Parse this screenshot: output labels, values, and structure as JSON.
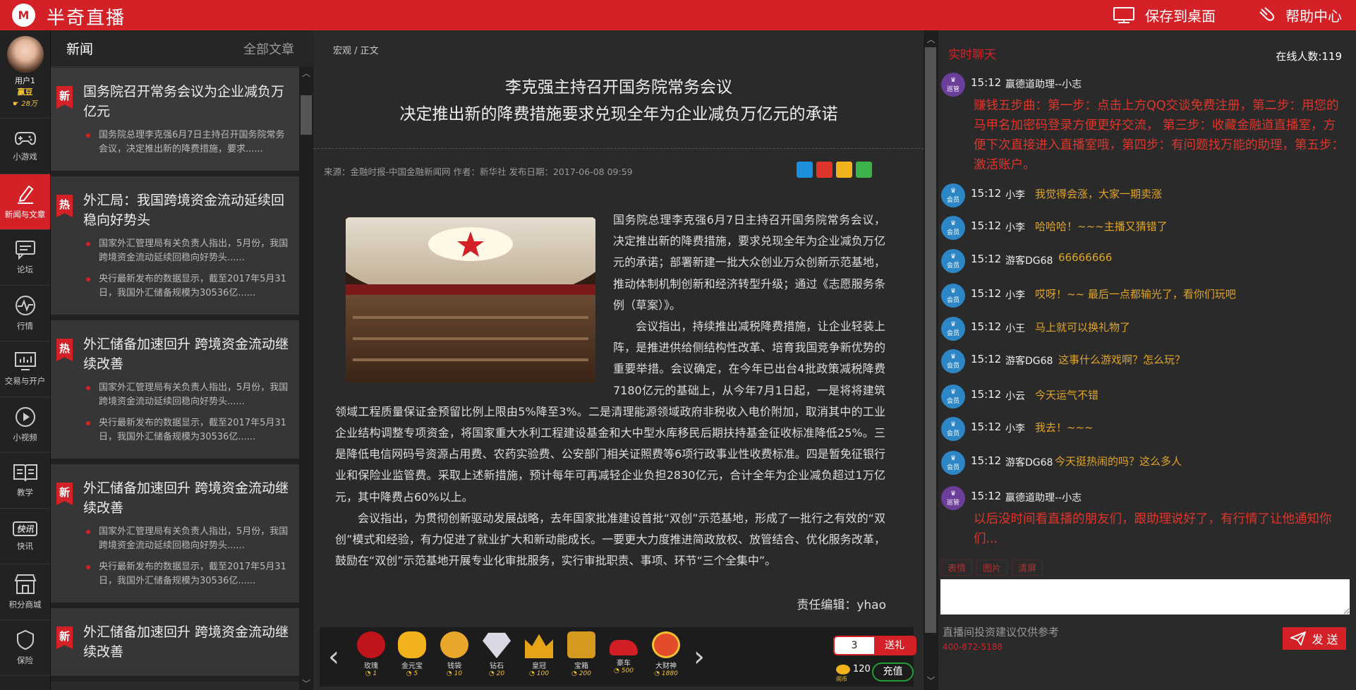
{
  "app": {
    "logo_letter": "M",
    "title": "半奇直播"
  },
  "top_actions": {
    "save_desktop": "保存到桌面",
    "help": "帮助中心"
  },
  "user": {
    "name": "用户1",
    "level": "赢豆",
    "beans": "28万"
  },
  "nav": [
    {
      "label": "小游戏",
      "icon": "gamepad-icon"
    },
    {
      "label": "新闻与文章",
      "icon": "edit-icon"
    },
    {
      "label": "论坛",
      "icon": "forum-icon"
    },
    {
      "label": "行情",
      "icon": "market-icon"
    },
    {
      "label": "交易与开户",
      "icon": "trading-icon"
    },
    {
      "label": "小视频",
      "icon": "video-icon"
    },
    {
      "label": "教学",
      "icon": "book-icon"
    },
    {
      "label": "快讯",
      "icon": "flash-icon",
      "badge_text": "快讯"
    },
    {
      "label": "积分商城",
      "icon": "shop-icon"
    },
    {
      "label": "保险",
      "icon": "shield-icon",
      "badge_text": "保"
    }
  ],
  "news": {
    "title": "新闻",
    "all_link": "全部文章",
    "items": [
      {
        "tag": "新",
        "title": "国务院召开常务会议为企业减负万亿元",
        "bullets": [
          "国务院总理李克强6月7日主持召开国务院常务会议，决定推出新的降费措施，要求......"
        ]
      },
      {
        "tag": "热",
        "title": "外汇局：我国跨境资金流动延续回稳向好势头",
        "bullets": [
          "国家外汇管理局有关负责人指出，5月份，我国跨境资金流动延续回稳向好势头......",
          "央行最新发布的数据显示，截至2017年5月31日，我国外汇储备规模为30536亿......"
        ]
      },
      {
        "tag": "热",
        "title": "外汇储备加速回升 跨境资金流动继续改善",
        "bullets": [
          "国家外汇管理局有关负责人指出，5月份，我国跨境资金流动延续回稳向好势头......",
          "央行最新发布的数据显示，截至2017年5月31日，我国外汇储备规模为30536亿......"
        ]
      },
      {
        "tag": "新",
        "title": "外汇储备加速回升 跨境资金流动继续改善",
        "bullets": [
          "国家外汇管理局有关负责人指出，5月份，我国跨境资金流动延续回稳向好势头......",
          "央行最新发布的数据显示，截至2017年5月31日，我国外汇储备规模为30536亿......"
        ]
      },
      {
        "tag": "新",
        "title": "外汇储备加速回升 跨境资金流动继续改善",
        "bullets": []
      }
    ]
  },
  "article": {
    "breadcrumb": "宏观 / 正文",
    "title_line1": "李克强主持召开国务院常务会议",
    "title_line2": "决定推出新的降费措施要求兑现全年为企业减负万亿元的承诺",
    "meta": "来源：金融时报-中国金融新闻网 作者：新华社 发布日期：2017-06-08 09:59",
    "p1": "国务院总理李克强6月7日主持召开国务院常务会议，决定推出新的降费措施，要求兑现全年为企业减负万亿元的承诺；部署新建一批大众创业万众创新示范基地，推动体制机制创新和经济转型升级；通过《志愿服务条例（草案）》。",
    "p2": "会议指出，持续推出减税降费措施，让企业轻装上阵，是推进供给侧结构性改革、培育我国竞争新优势的重要举措。会议确定，在今年已出台4批政策减税降费7180亿元的基础上，从今年7月1日起，一是将将建筑领域工程质量保证金预留比例上限由5%降至3%。二是清理能源领域政府非税收入电价附加，取消其中的工业企业结构调整专项资金，将国家重大水利工程建设基金和大中型水库移民后期扶持基金征收标准降低25%。三是降低电信网码号资源占用费、农药实验费、公安部门相关证照费等6项行政事业性收费标准。四是暂免征银行业和保险业监管费。采取上述新措施，预计每年可再减轻企业负担2830亿元，合计全年为企业减负超过1万亿元，其中降费占60%以上。",
    "p3": "会议指出，为贯彻创新驱动发展战略，去年国家批准建设首批“双创”示范基地，形成了一批行之有效的“双创”模式和经验，有力促进了就业扩大和新动能成长。一要更大力度推进简政放权、放管结合、优化服务改革，鼓励在“双创”示范基地开展专业化审批服务，实行审批职责、事项、环节“三个全集中”。",
    "editor": "责任编辑：yhao"
  },
  "gifts": [
    {
      "name": "玫瑰",
      "price": "1",
      "color": "#c0141b"
    },
    {
      "name": "金元宝",
      "price": "5",
      "color": "#f2b21c"
    },
    {
      "name": "钱袋",
      "price": "10",
      "color": "#e8a72a"
    },
    {
      "name": "钻石",
      "price": "20",
      "color": "#d9d9e6"
    },
    {
      "name": "皇冠",
      "price": "100",
      "color": "#e5a418"
    },
    {
      "name": "宝箱",
      "price": "200",
      "color": "#d69b1e"
    },
    {
      "name": "豪车",
      "price": "500",
      "color": "#d21e24"
    },
    {
      "name": "大财神",
      "price": "1880",
      "color": "#e34c2a"
    }
  ],
  "gift_send": {
    "quantity": "3",
    "send_label": "送礼",
    "coin_label": "闹币",
    "coin_count": "120",
    "recharge_label": "充值"
  },
  "chat": {
    "title": "实时聊天",
    "online": "在线人数:119",
    "messages": [
      {
        "time": "15:12",
        "user": "赢德道助理--小志",
        "role": "巡管",
        "text": "赚钱五步曲：第一步：点击上方QQ交谈免费注册，第二步：用您的马甲名加密码登录方便更好交流， 第三步：收藏金融道直播室，方便下次直接进入直播室哦，第四步：有问题找万能的助理，第五步：激活账户。"
      },
      {
        "time": "15:12",
        "user": "小李",
        "role": "会员",
        "text": "我觉得会涨，大家一期卖涨"
      },
      {
        "time": "15:12",
        "user": "小李",
        "role": "会员",
        "text": "哈哈哈！~~~主播又猜错了"
      },
      {
        "time": "15:12",
        "user": "游客DG68",
        "role": "会员",
        "text": "66666666"
      },
      {
        "time": "15:12",
        "user": "小李",
        "role": "会员",
        "text": "哎呀！~~ 最后一点都输光了，看你们玩吧"
      },
      {
        "time": "15:12",
        "user": "小王",
        "role": "会员",
        "text": "马上就可以换礼物了"
      },
      {
        "time": "15:12",
        "user": "游客DG68",
        "role": "会员",
        "text": "这事什么游戏啊？怎么玩？"
      },
      {
        "time": "15:12",
        "user": "小云",
        "role": "会员",
        "text": "今天运气不错"
      },
      {
        "time": "15:12",
        "user": "小李",
        "role": "会员",
        "text": "我去！~~~"
      },
      {
        "time": "15:12",
        "user": "游客DG68",
        "role": "会员",
        "text": "今天挺热闹的吗？这么多人"
      },
      {
        "time": "15:12",
        "user": "赢德道助理--小志",
        "role": "巡管",
        "text": "以后没时间看直播的朋友们，跟助理说好了，有行情了让他通知你们..."
      }
    ],
    "tools": [
      "表情",
      "图片",
      "清屏"
    ],
    "note": "直播间投资建议仅供参考",
    "phone": "400-872-5188",
    "send_label": "发 送"
  }
}
